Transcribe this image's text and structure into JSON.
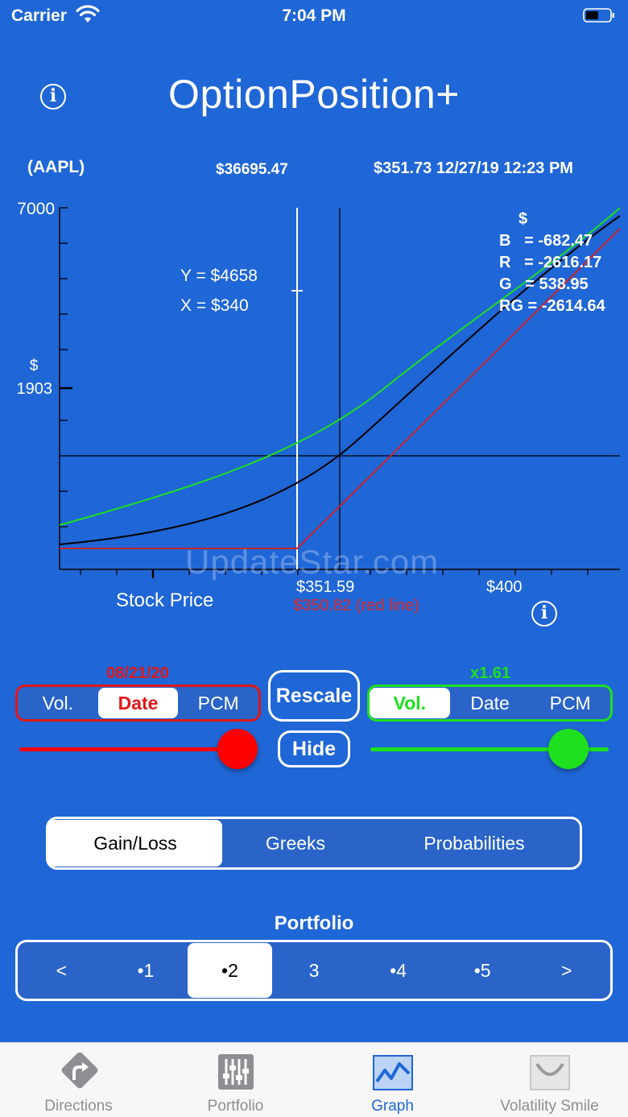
{
  "status_bar": {
    "carrier": "Carrier",
    "time": "7:04 PM"
  },
  "app": {
    "title": "OptionPosition+"
  },
  "ticker": {
    "symbol": "(AAPL)",
    "position_value": "$36695.47",
    "quote": "$351.73 12/27/19  12:23 PM"
  },
  "graph": {
    "y_top_label": "7000",
    "y_unit": "$",
    "y_mid_label": "1903",
    "cursor_y": "Y = $4658",
    "cursor_x": "X = $340",
    "readout_unit": "$",
    "readout_b": "B   = -682.47",
    "readout_r": "R   = -2616.17",
    "readout_g": "G   = 538.95",
    "readout_rg": "RG = -2614.64",
    "x_label_center": "$351.59",
    "x_label_400": "$400",
    "x_axis_title": "Stock Price",
    "red_line_price": "$350.82  (red line)",
    "watermark": "UpdateStar.com",
    "colors": {
      "black_curve": "#000000",
      "red_curve": "#c8232c",
      "green_curve": "#1ee01e",
      "cursor": "#ffffff"
    }
  },
  "controls": {
    "left_value": "08/21/20",
    "right_value": "x1.61",
    "left_segment": [
      "Vol.",
      "Date",
      "PCM"
    ],
    "right_segment": [
      "Vol.",
      "Date",
      "PCM"
    ],
    "rescale_label": "Rescale",
    "hide_label": "Hide",
    "left_slider_level": 0.92,
    "right_slider_level": 0.84,
    "left_color": "#ff0000",
    "right_color": "#00ff00"
  },
  "view_tabs": [
    "Gain/Loss",
    "Greeks",
    "Probabilities"
  ],
  "portfolio": {
    "title": "Portfolio",
    "items": [
      "<",
      "•1",
      "•2",
      "3",
      "•4",
      "•5",
      ">"
    ]
  },
  "tabbar": [
    {
      "label": "Directions",
      "icon": "directions-icon"
    },
    {
      "label": "Portfolio",
      "icon": "sliders-icon"
    },
    {
      "label": "Graph",
      "icon": "graph-icon"
    },
    {
      "label": "Volatility Smile",
      "icon": "smile-curve-icon"
    }
  ]
}
